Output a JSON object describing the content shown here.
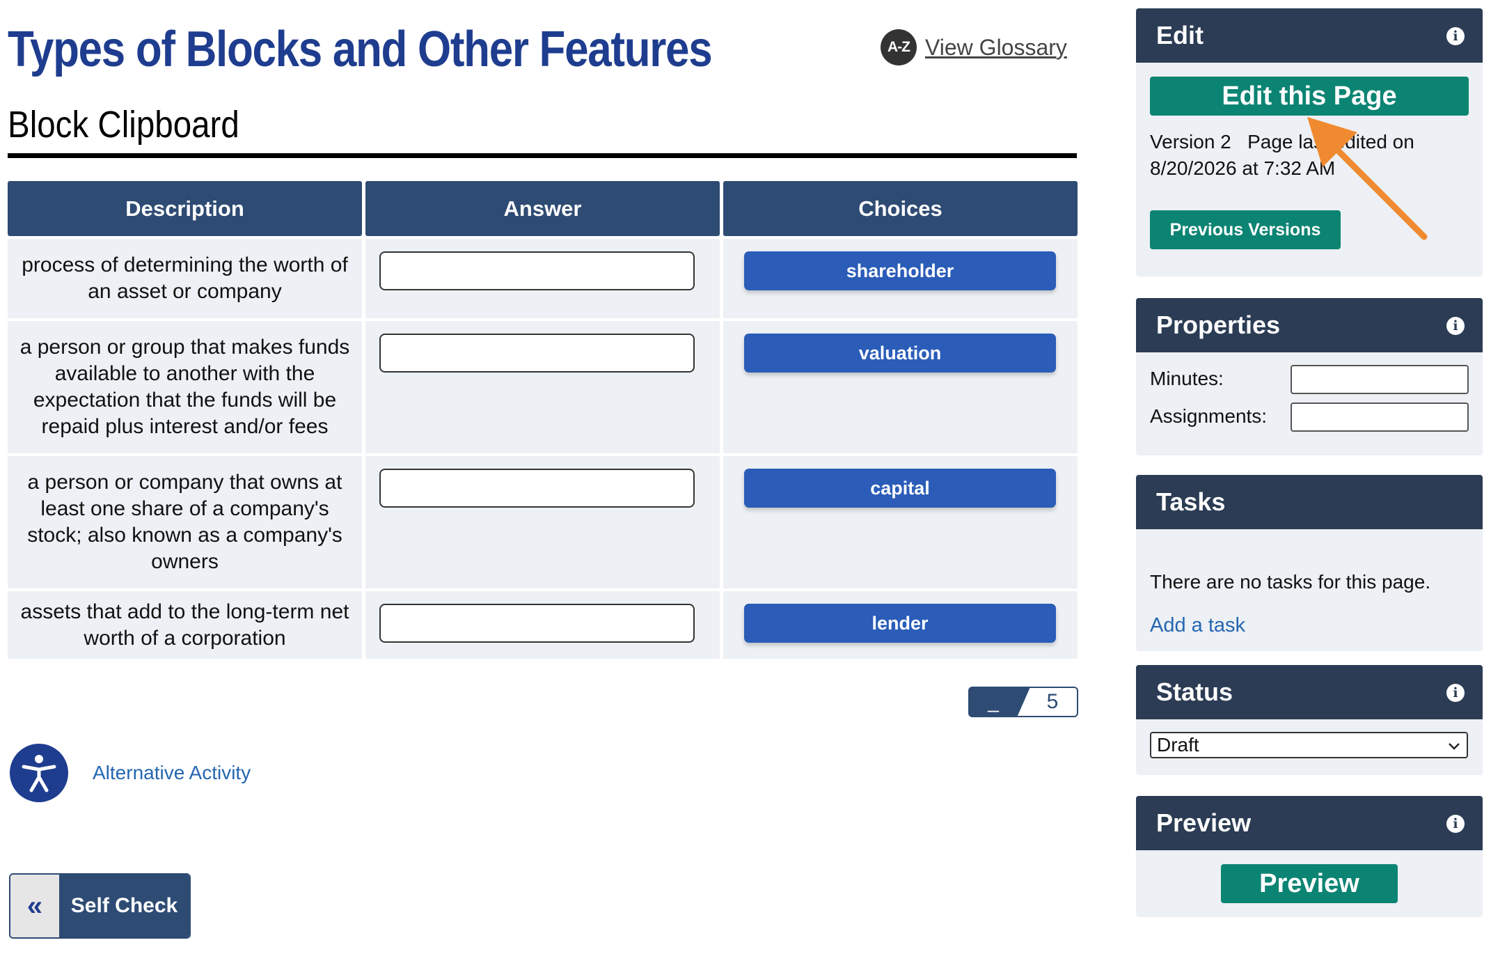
{
  "header": {
    "title": "Types of Blocks and Other Features",
    "glossary_badge": "A-Z",
    "glossary_link": "View Glossary"
  },
  "section": {
    "title": "Block Clipboard"
  },
  "table": {
    "headers": [
      "Description",
      "Answer",
      "Choices"
    ],
    "rows": [
      {
        "description": "process of determining the worth of an asset or company",
        "answer": "",
        "choice": "shareholder"
      },
      {
        "description": "a person or group that makes funds available to another with the expectation that the funds will be repaid plus interest and/or fees",
        "answer": "",
        "choice": "valuation"
      },
      {
        "description": "a person or company that owns at least one share of a company's stock; also known as a company's owners",
        "answer": "",
        "choice": "capital"
      },
      {
        "description": "assets that add to the long-term net worth of a corporation",
        "answer": "",
        "choice": "lender"
      }
    ]
  },
  "counter": {
    "current": "_",
    "total": "5"
  },
  "alternative_activity": "Alternative Activity",
  "self_check": {
    "label": "Self Check",
    "chevron": "«"
  },
  "sidebar": {
    "edit": {
      "title": "Edit",
      "edit_button": "Edit this Page",
      "version": "Version 2",
      "last_edited_line1": "Page last edited on",
      "last_edited_line2": "8/20/2026 at 7:32 AM",
      "previous_versions": "Previous Versions"
    },
    "properties": {
      "title": "Properties",
      "minutes_label": "Minutes:",
      "minutes_value": "",
      "assignments_label": "Assignments:",
      "assignments_value": ""
    },
    "tasks": {
      "title": "Tasks",
      "empty_text": "There are no tasks for this page.",
      "add_link": "Add a task"
    },
    "status": {
      "title": "Status",
      "selected": "Draft"
    },
    "preview": {
      "title": "Preview",
      "button": "Preview"
    }
  },
  "colors": {
    "title_blue": "#1f3d8f",
    "header_navy": "#2e4b73",
    "choice_blue": "#2a5cb8",
    "panel_head": "#2b3c54",
    "green": "#0c8473",
    "arrow_orange": "#f08a30"
  },
  "icons": [
    "info-icon",
    "accessibility-icon",
    "chevron-down-icon",
    "double-chevron-left-icon"
  ]
}
